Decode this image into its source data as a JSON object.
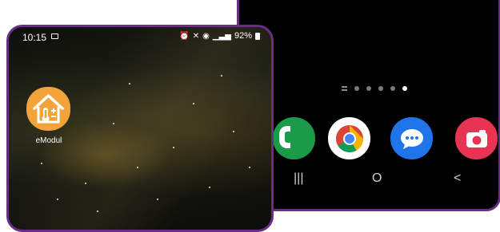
{
  "back_phone": {
    "page_indicator": {
      "total_dots": 5,
      "active_index": 4
    },
    "dock": [
      {
        "name": "phone-app",
        "icon": "phone-icon",
        "color": "#1b9a4a"
      },
      {
        "name": "chrome-app",
        "icon": "chrome-icon",
        "color": "#ffffff"
      },
      {
        "name": "messages-app",
        "icon": "message-icon",
        "color": "#1e74e8"
      },
      {
        "name": "camera-app",
        "icon": "camera-icon",
        "color": "#e63452"
      }
    ],
    "navbar": {
      "recents": "|||",
      "home": "O",
      "back": "<"
    }
  },
  "front_phone": {
    "status_bar": {
      "time": "10:15",
      "battery": "92%"
    },
    "home_app": {
      "label": "eModul",
      "icon": "house-thermometer-icon",
      "color": "#f2a33a"
    }
  },
  "colors": {
    "frame": "#6a2d86"
  }
}
